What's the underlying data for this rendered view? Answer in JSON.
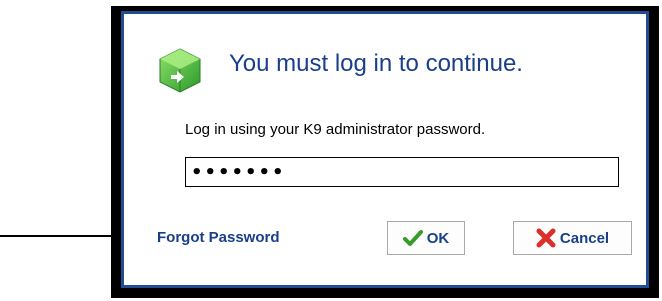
{
  "dialog": {
    "title": "You must log in to continue.",
    "title_icon": "green-box-icon",
    "instructions": "Log in using your K9 administrator password.",
    "password": {
      "value": "•••••••",
      "masked": true
    },
    "forgot_password_label": "Forgot Password",
    "ok_label": "OK",
    "cancel_label": "Cancel"
  },
  "annotation": {
    "arrow_icon": "arrow-right-icon"
  },
  "colors": {
    "accent": "#1a3f8a",
    "frame": "#000000",
    "ok_check": "#3a9a2a",
    "cancel_x": "#d9302c",
    "icon_green": "#3fae3a"
  }
}
